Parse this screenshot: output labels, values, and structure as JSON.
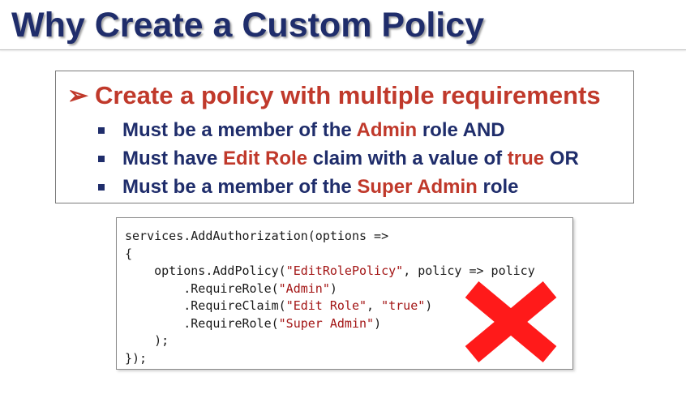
{
  "slide": {
    "title": "Why Create a Custom Policy",
    "headline": {
      "arrow": "➢",
      "text": "Create a policy with multiple requirements"
    },
    "bullets": [
      {
        "a": "Must be a member of the ",
        "b": "Admin",
        "c": " role AND"
      },
      {
        "a": "Must have ",
        "b": "Edit Role",
        "c": " claim with a value of ",
        "d": "true",
        "e": " OR"
      },
      {
        "a": "Must be a member of the ",
        "b": "Super Admin",
        "c": " role"
      }
    ],
    "code": {
      "l1": "services.AddAuthorization(options =>",
      "l2": "{",
      "l3_indent": "    options.AddPolicy(",
      "l3_str": "\"EditRolePolicy\"",
      "l3_rest": ", policy => policy",
      "l4_pre": "        .RequireRole(",
      "l4_str": "\"Admin\"",
      "l4_post": ")",
      "l5_pre": "        .RequireClaim(",
      "l5_str1": "\"Edit Role\"",
      "l5_mid": ", ",
      "l5_str2": "\"true\"",
      "l5_post": ")",
      "l6_pre": "        .RequireRole(",
      "l6_str": "\"Super Admin\"",
      "l6_post": ")",
      "l7": "    );",
      "l8": "});"
    },
    "x_mark_icon": "red-x-icon",
    "colors": {
      "navy": "#1f2d6b",
      "red": "#c0392b",
      "x_red": "#ff1a1a",
      "string": "#a31515"
    }
  }
}
